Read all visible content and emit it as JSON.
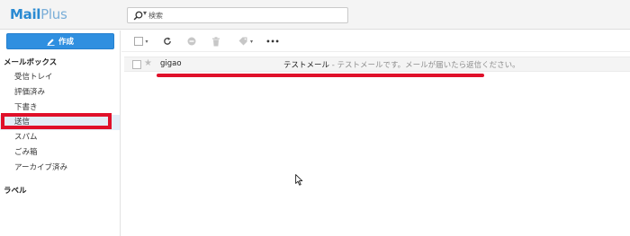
{
  "app": {
    "logo_part1": "Mail",
    "logo_part2": "Plus"
  },
  "search": {
    "placeholder": "検索"
  },
  "sidebar": {
    "compose_label": "作成",
    "mailbox_section": "メールボックス",
    "items": [
      {
        "label": "受信トレイ"
      },
      {
        "label": "評価済み"
      },
      {
        "label": "下書き"
      },
      {
        "label": "送信"
      },
      {
        "label": "スパム"
      },
      {
        "label": "ごみ箱"
      },
      {
        "label": "アーカイブ済み"
      }
    ],
    "labels_section": "ラベル"
  },
  "toolbar": {
    "more_label": "•••"
  },
  "messages": [
    {
      "from": "gigao",
      "subject": "テストメール",
      "preview": " - テストメールです。メールが届いたら返信ください。"
    }
  ],
  "colors": {
    "accent": "#2f8fe0",
    "annotation": "#e0102a"
  }
}
